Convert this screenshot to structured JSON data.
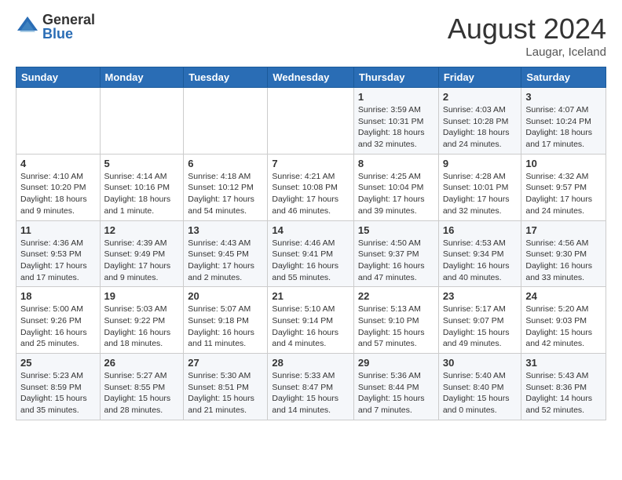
{
  "header": {
    "logo_general": "General",
    "logo_blue": "Blue",
    "month_title": "August 2024",
    "location": "Laugar, Iceland"
  },
  "days_of_week": [
    "Sunday",
    "Monday",
    "Tuesday",
    "Wednesday",
    "Thursday",
    "Friday",
    "Saturday"
  ],
  "weeks": [
    [
      {
        "day": "",
        "info": ""
      },
      {
        "day": "",
        "info": ""
      },
      {
        "day": "",
        "info": ""
      },
      {
        "day": "",
        "info": ""
      },
      {
        "day": "1",
        "info": "Sunrise: 3:59 AM\nSunset: 10:31 PM\nDaylight: 18 hours\nand 32 minutes."
      },
      {
        "day": "2",
        "info": "Sunrise: 4:03 AM\nSunset: 10:28 PM\nDaylight: 18 hours\nand 24 minutes."
      },
      {
        "day": "3",
        "info": "Sunrise: 4:07 AM\nSunset: 10:24 PM\nDaylight: 18 hours\nand 17 minutes."
      }
    ],
    [
      {
        "day": "4",
        "info": "Sunrise: 4:10 AM\nSunset: 10:20 PM\nDaylight: 18 hours\nand 9 minutes."
      },
      {
        "day": "5",
        "info": "Sunrise: 4:14 AM\nSunset: 10:16 PM\nDaylight: 18 hours\nand 1 minute."
      },
      {
        "day": "6",
        "info": "Sunrise: 4:18 AM\nSunset: 10:12 PM\nDaylight: 17 hours\nand 54 minutes."
      },
      {
        "day": "7",
        "info": "Sunrise: 4:21 AM\nSunset: 10:08 PM\nDaylight: 17 hours\nand 46 minutes."
      },
      {
        "day": "8",
        "info": "Sunrise: 4:25 AM\nSunset: 10:04 PM\nDaylight: 17 hours\nand 39 minutes."
      },
      {
        "day": "9",
        "info": "Sunrise: 4:28 AM\nSunset: 10:01 PM\nDaylight: 17 hours\nand 32 minutes."
      },
      {
        "day": "10",
        "info": "Sunrise: 4:32 AM\nSunset: 9:57 PM\nDaylight: 17 hours\nand 24 minutes."
      }
    ],
    [
      {
        "day": "11",
        "info": "Sunrise: 4:36 AM\nSunset: 9:53 PM\nDaylight: 17 hours\nand 17 minutes."
      },
      {
        "day": "12",
        "info": "Sunrise: 4:39 AM\nSunset: 9:49 PM\nDaylight: 17 hours\nand 9 minutes."
      },
      {
        "day": "13",
        "info": "Sunrise: 4:43 AM\nSunset: 9:45 PM\nDaylight: 17 hours\nand 2 minutes."
      },
      {
        "day": "14",
        "info": "Sunrise: 4:46 AM\nSunset: 9:41 PM\nDaylight: 16 hours\nand 55 minutes."
      },
      {
        "day": "15",
        "info": "Sunrise: 4:50 AM\nSunset: 9:37 PM\nDaylight: 16 hours\nand 47 minutes."
      },
      {
        "day": "16",
        "info": "Sunrise: 4:53 AM\nSunset: 9:34 PM\nDaylight: 16 hours\nand 40 minutes."
      },
      {
        "day": "17",
        "info": "Sunrise: 4:56 AM\nSunset: 9:30 PM\nDaylight: 16 hours\nand 33 minutes."
      }
    ],
    [
      {
        "day": "18",
        "info": "Sunrise: 5:00 AM\nSunset: 9:26 PM\nDaylight: 16 hours\nand 25 minutes."
      },
      {
        "day": "19",
        "info": "Sunrise: 5:03 AM\nSunset: 9:22 PM\nDaylight: 16 hours\nand 18 minutes."
      },
      {
        "day": "20",
        "info": "Sunrise: 5:07 AM\nSunset: 9:18 PM\nDaylight: 16 hours\nand 11 minutes."
      },
      {
        "day": "21",
        "info": "Sunrise: 5:10 AM\nSunset: 9:14 PM\nDaylight: 16 hours\nand 4 minutes."
      },
      {
        "day": "22",
        "info": "Sunrise: 5:13 AM\nSunset: 9:10 PM\nDaylight: 15 hours\nand 57 minutes."
      },
      {
        "day": "23",
        "info": "Sunrise: 5:17 AM\nSunset: 9:07 PM\nDaylight: 15 hours\nand 49 minutes."
      },
      {
        "day": "24",
        "info": "Sunrise: 5:20 AM\nSunset: 9:03 PM\nDaylight: 15 hours\nand 42 minutes."
      }
    ],
    [
      {
        "day": "25",
        "info": "Sunrise: 5:23 AM\nSunset: 8:59 PM\nDaylight: 15 hours\nand 35 minutes."
      },
      {
        "day": "26",
        "info": "Sunrise: 5:27 AM\nSunset: 8:55 PM\nDaylight: 15 hours\nand 28 minutes."
      },
      {
        "day": "27",
        "info": "Sunrise: 5:30 AM\nSunset: 8:51 PM\nDaylight: 15 hours\nand 21 minutes."
      },
      {
        "day": "28",
        "info": "Sunrise: 5:33 AM\nSunset: 8:47 PM\nDaylight: 15 hours\nand 14 minutes."
      },
      {
        "day": "29",
        "info": "Sunrise: 5:36 AM\nSunset: 8:44 PM\nDaylight: 15 hours\nand 7 minutes."
      },
      {
        "day": "30",
        "info": "Sunrise: 5:40 AM\nSunset: 8:40 PM\nDaylight: 15 hours\nand 0 minutes."
      },
      {
        "day": "31",
        "info": "Sunrise: 5:43 AM\nSunset: 8:36 PM\nDaylight: 14 hours\nand 52 minutes."
      }
    ]
  ]
}
